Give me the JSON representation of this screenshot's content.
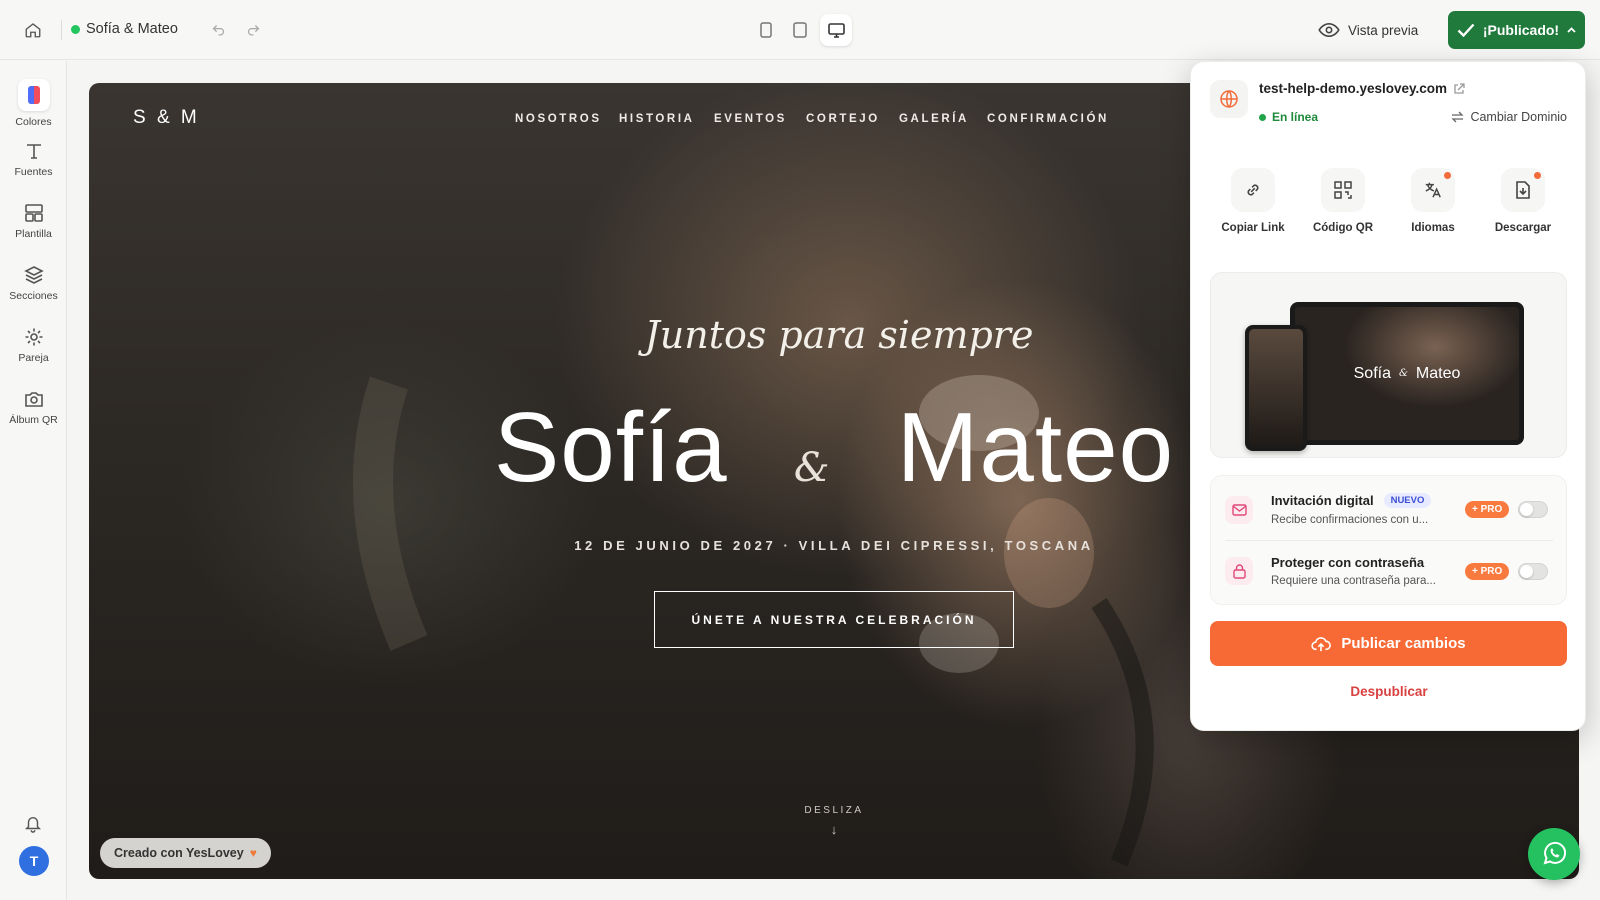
{
  "app": {
    "site_title": "Sofía & Mateo",
    "preview_label": "Vista previa",
    "published_label": "¡Publicado!",
    "status_color": "#22c55e",
    "accent": "#1f7a3c"
  },
  "sidebar": {
    "items": [
      {
        "label": "Colores",
        "icon": "palette-icon"
      },
      {
        "label": "Fuentes",
        "icon": "type-icon"
      },
      {
        "label": "Plantilla",
        "icon": "layout-icon"
      },
      {
        "label": "Secciones",
        "icon": "layers-icon"
      },
      {
        "label": "Pareja",
        "icon": "gear-icon"
      },
      {
        "label": "Álbum QR",
        "icon": "camera-icon"
      }
    ],
    "avatar_initial": "T"
  },
  "site": {
    "logo": "S & M",
    "nav": [
      "NOSOTROS",
      "HISTORIA",
      "EVENTOS",
      "CORTEJO",
      "GALERÍA",
      "CONFIRMACIÓN"
    ],
    "script_title": "Juntos para siempre",
    "name_left": "Sofía",
    "ampersand": "&",
    "name_right": "Mateo",
    "date_place": "12 DE JUNIO DE 2027 · VILLA DEI CIPRESSI, TOSCANA",
    "cta": "ÚNETE A NUESTRA CELEBRACIÓN",
    "scroll_label": "DESLIZA",
    "badge": "Creado con YesLovey"
  },
  "panel": {
    "domain": "test-help-demo.yeslovey.com",
    "status": "En línea",
    "change_domain": "Cambiar Dominio",
    "actions": [
      {
        "label": "Copiar Link",
        "icon": "link-icon"
      },
      {
        "label": "Código QR",
        "icon": "qr-icon"
      },
      {
        "label": "Idiomas",
        "icon": "translate-icon"
      },
      {
        "label": "Descargar",
        "icon": "download-icon"
      }
    ],
    "preview_name_left": "Sofía",
    "preview_name_right": "Mateo",
    "features": [
      {
        "title": "Invitación digital",
        "tag": "NUEVO",
        "desc": "Recibe confirmaciones con u...",
        "pro": "PRO",
        "enabled": false
      },
      {
        "title": "Proteger con contraseña",
        "desc": "Requiere una contraseña para...",
        "pro": "PRO",
        "enabled": false
      }
    ],
    "publish": "Publicar cambios",
    "unpublish": "Despublicar",
    "publish_color": "#f76a35"
  }
}
